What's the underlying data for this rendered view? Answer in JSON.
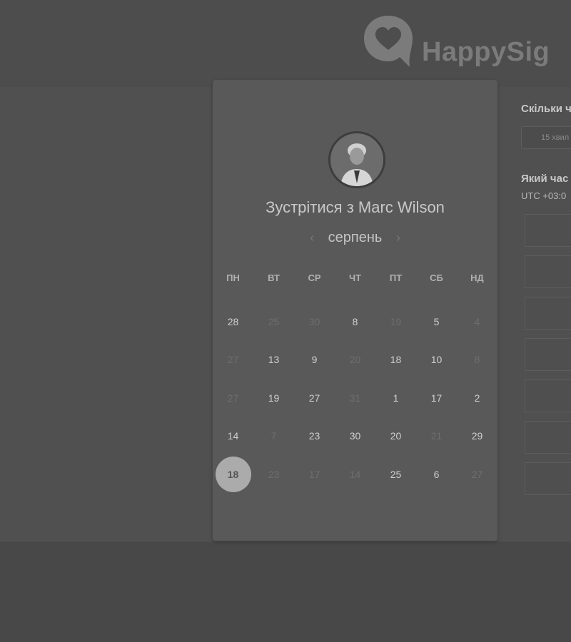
{
  "brand": {
    "name": "HappySig"
  },
  "meeting": {
    "title_prefix": "Зустрітися з",
    "person": "Marc Wilson"
  },
  "calendar": {
    "month": "серпень",
    "prev_icon": "chevron-left-icon",
    "next_icon": "chevron-right-icon",
    "weekdays": [
      "ПН",
      "ВТ",
      "СР",
      "ЧТ",
      "ПТ",
      "СБ",
      "НД"
    ],
    "weeks": [
      [
        "28",
        "25",
        "30",
        "8",
        "19",
        "5",
        "4"
      ],
      [
        "27",
        "13",
        "9",
        "20",
        "18",
        "10",
        "8"
      ],
      [
        "27",
        "19",
        "27",
        "31",
        "1",
        "17",
        "2"
      ],
      [
        "14",
        "7",
        "23",
        "30",
        "20",
        "21",
        "29"
      ],
      [
        "18",
        "23",
        "17",
        "14",
        "25",
        "6",
        "27"
      ]
    ],
    "available": [
      [
        true,
        false,
        false,
        true,
        false,
        true,
        false
      ],
      [
        false,
        true,
        true,
        false,
        true,
        true,
        false
      ],
      [
        false,
        true,
        true,
        false,
        true,
        true,
        true
      ],
      [
        true,
        false,
        true,
        true,
        true,
        false,
        true
      ],
      [
        true,
        false,
        false,
        false,
        true,
        true,
        false
      ]
    ],
    "selected": {
      "week": 4,
      "day": 0
    }
  },
  "side": {
    "duration_heading": "Скільки ч",
    "duration_value": "15 хвил",
    "time_heading": "Який час",
    "timezone": "UTC +03:0"
  },
  "colors": {
    "background": "#4a4a4a",
    "card": "#595959",
    "selected_day": "#ababab"
  }
}
